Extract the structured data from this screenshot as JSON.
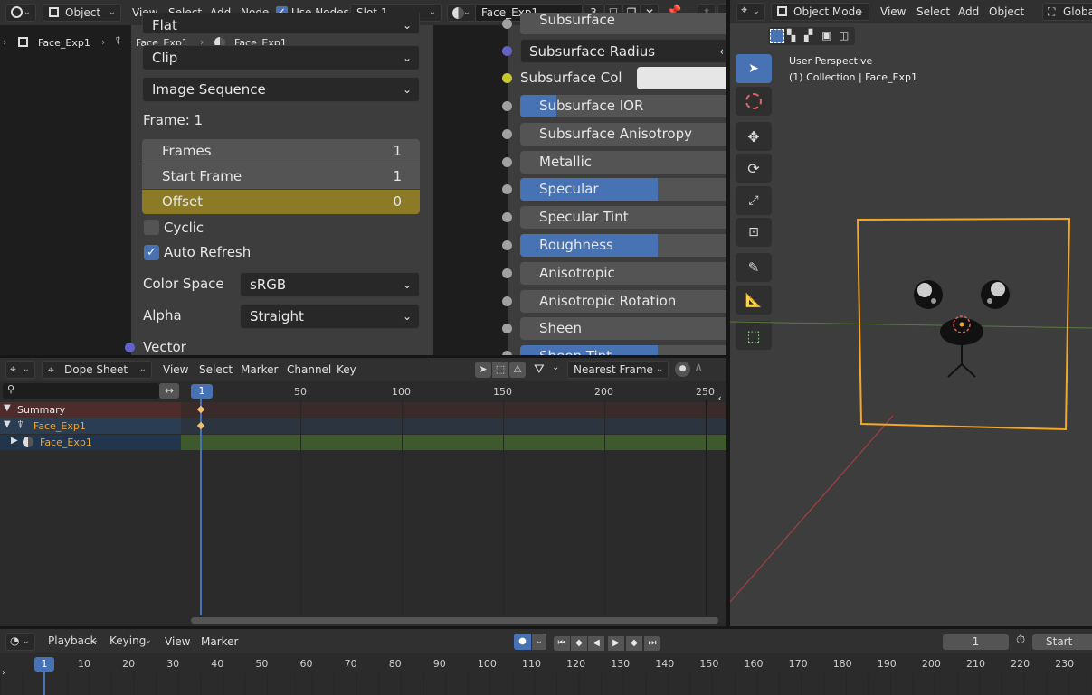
{
  "node_editor": {
    "header": {
      "editor_type_icon": "node-editor-icon",
      "object_dropdown": "Object",
      "menus": [
        "View",
        "Select",
        "Add",
        "Node"
      ],
      "use_nodes_label": "Use Nodes",
      "use_nodes_checked": true,
      "slot": "Slot 1",
      "material_name": "Face_Exp1",
      "user_count": "3"
    },
    "breadcrumb": {
      "object": "Face_Exp1",
      "mesh": "Face_Exp1",
      "material": "Face_Exp1"
    },
    "image_panel": {
      "flat": "Flat",
      "clip": "Clip",
      "source": "Image Sequence",
      "frame_label": "Frame: 1",
      "frames_label": "Frames",
      "frames_value": "1",
      "start_label": "Start Frame",
      "start_value": "1",
      "offset_label": "Offset",
      "offset_value": "0",
      "cyclic_label": "Cyclic",
      "cyclic_checked": false,
      "auto_refresh_label": "Auto Refresh",
      "auto_refresh_checked": true,
      "color_space_label": "Color Space",
      "color_space_value": "sRGB",
      "alpha_label": "Alpha",
      "alpha_value": "Straight",
      "vector_label": "Vector"
    },
    "bsdf_inputs": [
      {
        "label": "Subsurface",
        "fill": 0
      },
      {
        "label": "Subsurface Radius",
        "fill": 0
      },
      {
        "label": "Subsurface Col",
        "fill": 0
      },
      {
        "label": "Subsurface IOR",
        "fill": 0.18
      },
      {
        "label": "Subsurface Anisotropy",
        "fill": 0
      },
      {
        "label": "Metallic",
        "fill": 0
      },
      {
        "label": "Specular",
        "fill": 0.5
      },
      {
        "label": "Specular Tint",
        "fill": 0
      },
      {
        "label": "Roughness",
        "fill": 0.5
      },
      {
        "label": "Anisotropic",
        "fill": 0
      },
      {
        "label": "Anisotropic Rotation",
        "fill": 0
      },
      {
        "label": "Sheen",
        "fill": 0
      },
      {
        "label": "Sheen Tint",
        "fill": 0.5
      }
    ]
  },
  "viewport": {
    "header": {
      "mode": "Object Mode",
      "menus": [
        "View",
        "Select",
        "Add",
        "Object"
      ],
      "orientation": "Global"
    },
    "overlay_line1": "User Perspective",
    "overlay_line2": "(1) Collection | Face_Exp1",
    "tools": [
      "select-box-icon",
      "cursor-icon",
      "move-icon",
      "rotate-icon",
      "scale-icon",
      "transform-icon",
      "annotate-icon",
      "measure-icon",
      "add-cube-icon"
    ]
  },
  "dope_sheet": {
    "header": {
      "mode": "Dope Sheet",
      "menus": [
        "View",
        "Select",
        "Marker",
        "Channel",
        "Key"
      ],
      "snap": "Nearest Frame"
    },
    "current_frame": "1",
    "ruler_ticks": [
      "50",
      "100",
      "150",
      "200",
      "250"
    ],
    "channels": [
      {
        "label": "Summary"
      },
      {
        "label": "Face_Exp1"
      },
      {
        "label": "Face_Exp1"
      }
    ]
  },
  "timeline": {
    "header": {
      "menus": [
        "Playback",
        "Keying",
        "View",
        "Marker"
      ],
      "current_frame": "1",
      "start_label": "Start"
    },
    "current_frame": "1",
    "ruler_ticks": [
      "10",
      "20",
      "30",
      "40",
      "50",
      "60",
      "70",
      "80",
      "90",
      "100",
      "110",
      "120",
      "130",
      "140",
      "150",
      "160",
      "170",
      "180",
      "190",
      "200",
      "210",
      "220",
      "230"
    ]
  },
  "colors": {
    "accent": "#4772b3",
    "selection_orange": "#f5a623",
    "offset_yellow": "#8c7a26",
    "summary_row": "#4e2c2c",
    "object_row": "#2a3d52",
    "material_row": "#3e5a2c"
  }
}
